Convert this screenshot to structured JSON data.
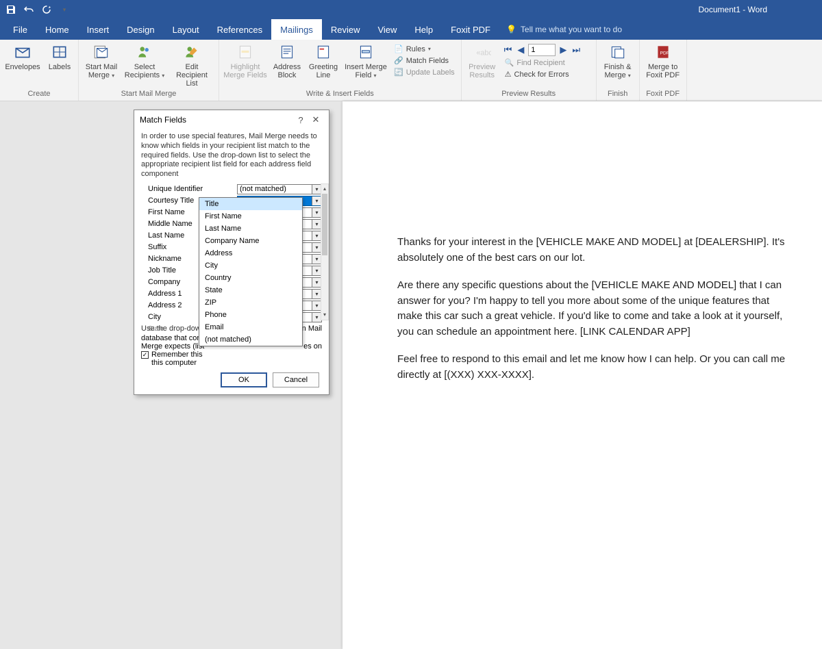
{
  "app": {
    "title": "Document1 - Word"
  },
  "qat": {
    "save": "Save",
    "undo": "Undo",
    "redo": "Redo",
    "repeat": "Repeat"
  },
  "tabs": [
    "File",
    "Home",
    "Insert",
    "Design",
    "Layout",
    "References",
    "Mailings",
    "Review",
    "View",
    "Help",
    "Foxit PDF"
  ],
  "tellme": "Tell me what you want to do",
  "ribbon": {
    "create": {
      "label": "Create",
      "envelopes": "Envelopes",
      "labels": "Labels"
    },
    "startmm": {
      "label": "Start Mail Merge",
      "start": "Start Mail\nMerge",
      "select": "Select\nRecipients",
      "edit": "Edit\nRecipient List"
    },
    "write": {
      "label": "Write & Insert Fields",
      "highlight": "Highlight\nMerge Fields",
      "address": "Address\nBlock",
      "greeting": "Greeting\nLine",
      "insert": "Insert Merge\nField",
      "rules": "Rules",
      "match": "Match Fields",
      "update": "Update Labels"
    },
    "preview": {
      "label": "Preview Results",
      "preview": "Preview\nResults",
      "record": "1",
      "find": "Find Recipient",
      "check": "Check for Errors"
    },
    "finish": {
      "label": "Finish",
      "finish": "Finish &\nMerge"
    },
    "foxit": {
      "label": "Foxit PDF",
      "merge": "Merge to\nFoxit PDF"
    }
  },
  "document": {
    "p1": "Thanks for your interest in the [VEHICLE MAKE AND MODEL] at [DEALERSHIP]. It's absolutely one of the best cars on our lot.",
    "p2": "Are there any specific questions about the [VEHICLE MAKE AND MODEL] that I can answer for you? I'm happy to tell you more about some of the unique features that make this car such a great vehicle. If you'd like to come and take a look at it yourself, you can schedule an appointment here. [LINK CALENDAR APP]",
    "p3": "Feel free to respond to this email and let me know how I can help. Or you can call me directly at [(XXX) XXX-XXXX]."
  },
  "dialog": {
    "title": "Match Fields",
    "desc": "In order to use special features, Mail Merge needs to know which fields in your recipient list match to the required fields.  Use the drop-down list to select the appropriate recipient list field for each address field component",
    "fields": [
      {
        "label": "Unique Identifier",
        "value": "(not matched)"
      },
      {
        "label": "Courtesy Title",
        "value": "Title",
        "selected": true
      },
      {
        "label": "First Name",
        "value": ""
      },
      {
        "label": "Middle Name",
        "value": ""
      },
      {
        "label": "Last Name",
        "value": ""
      },
      {
        "label": "Suffix",
        "value": ""
      },
      {
        "label": "Nickname",
        "value": ""
      },
      {
        "label": "Job Title",
        "value": ""
      },
      {
        "label": "Company",
        "value": ""
      },
      {
        "label": "Address 1",
        "value": ""
      },
      {
        "label": "Address 2",
        "value": ""
      },
      {
        "label": "City",
        "value": ""
      },
      {
        "label": "State",
        "value": ""
      }
    ],
    "hint": "Use the drop-down                                                    n Mail\ndatabase that corre\nMerge expects (list",
    "hint_a": "Use the drop-down",
    "hint_b": "database that corr",
    "hint_c": "Merge expects (list",
    "hint_r1": "n Mail",
    "hint_r2": "es on",
    "remember": "Remember this\nthis computer",
    "remember_a": "Remember this",
    "remember_b": "this computer",
    "ok": "OK",
    "cancel": "Cancel"
  },
  "dropdown": {
    "items": [
      "Title",
      "First Name",
      "Last Name",
      "Company Name",
      "Address",
      "City",
      "Country",
      "State",
      "ZIP",
      "Phone",
      "Email",
      "(not matched)"
    ],
    "selected": "Title"
  }
}
